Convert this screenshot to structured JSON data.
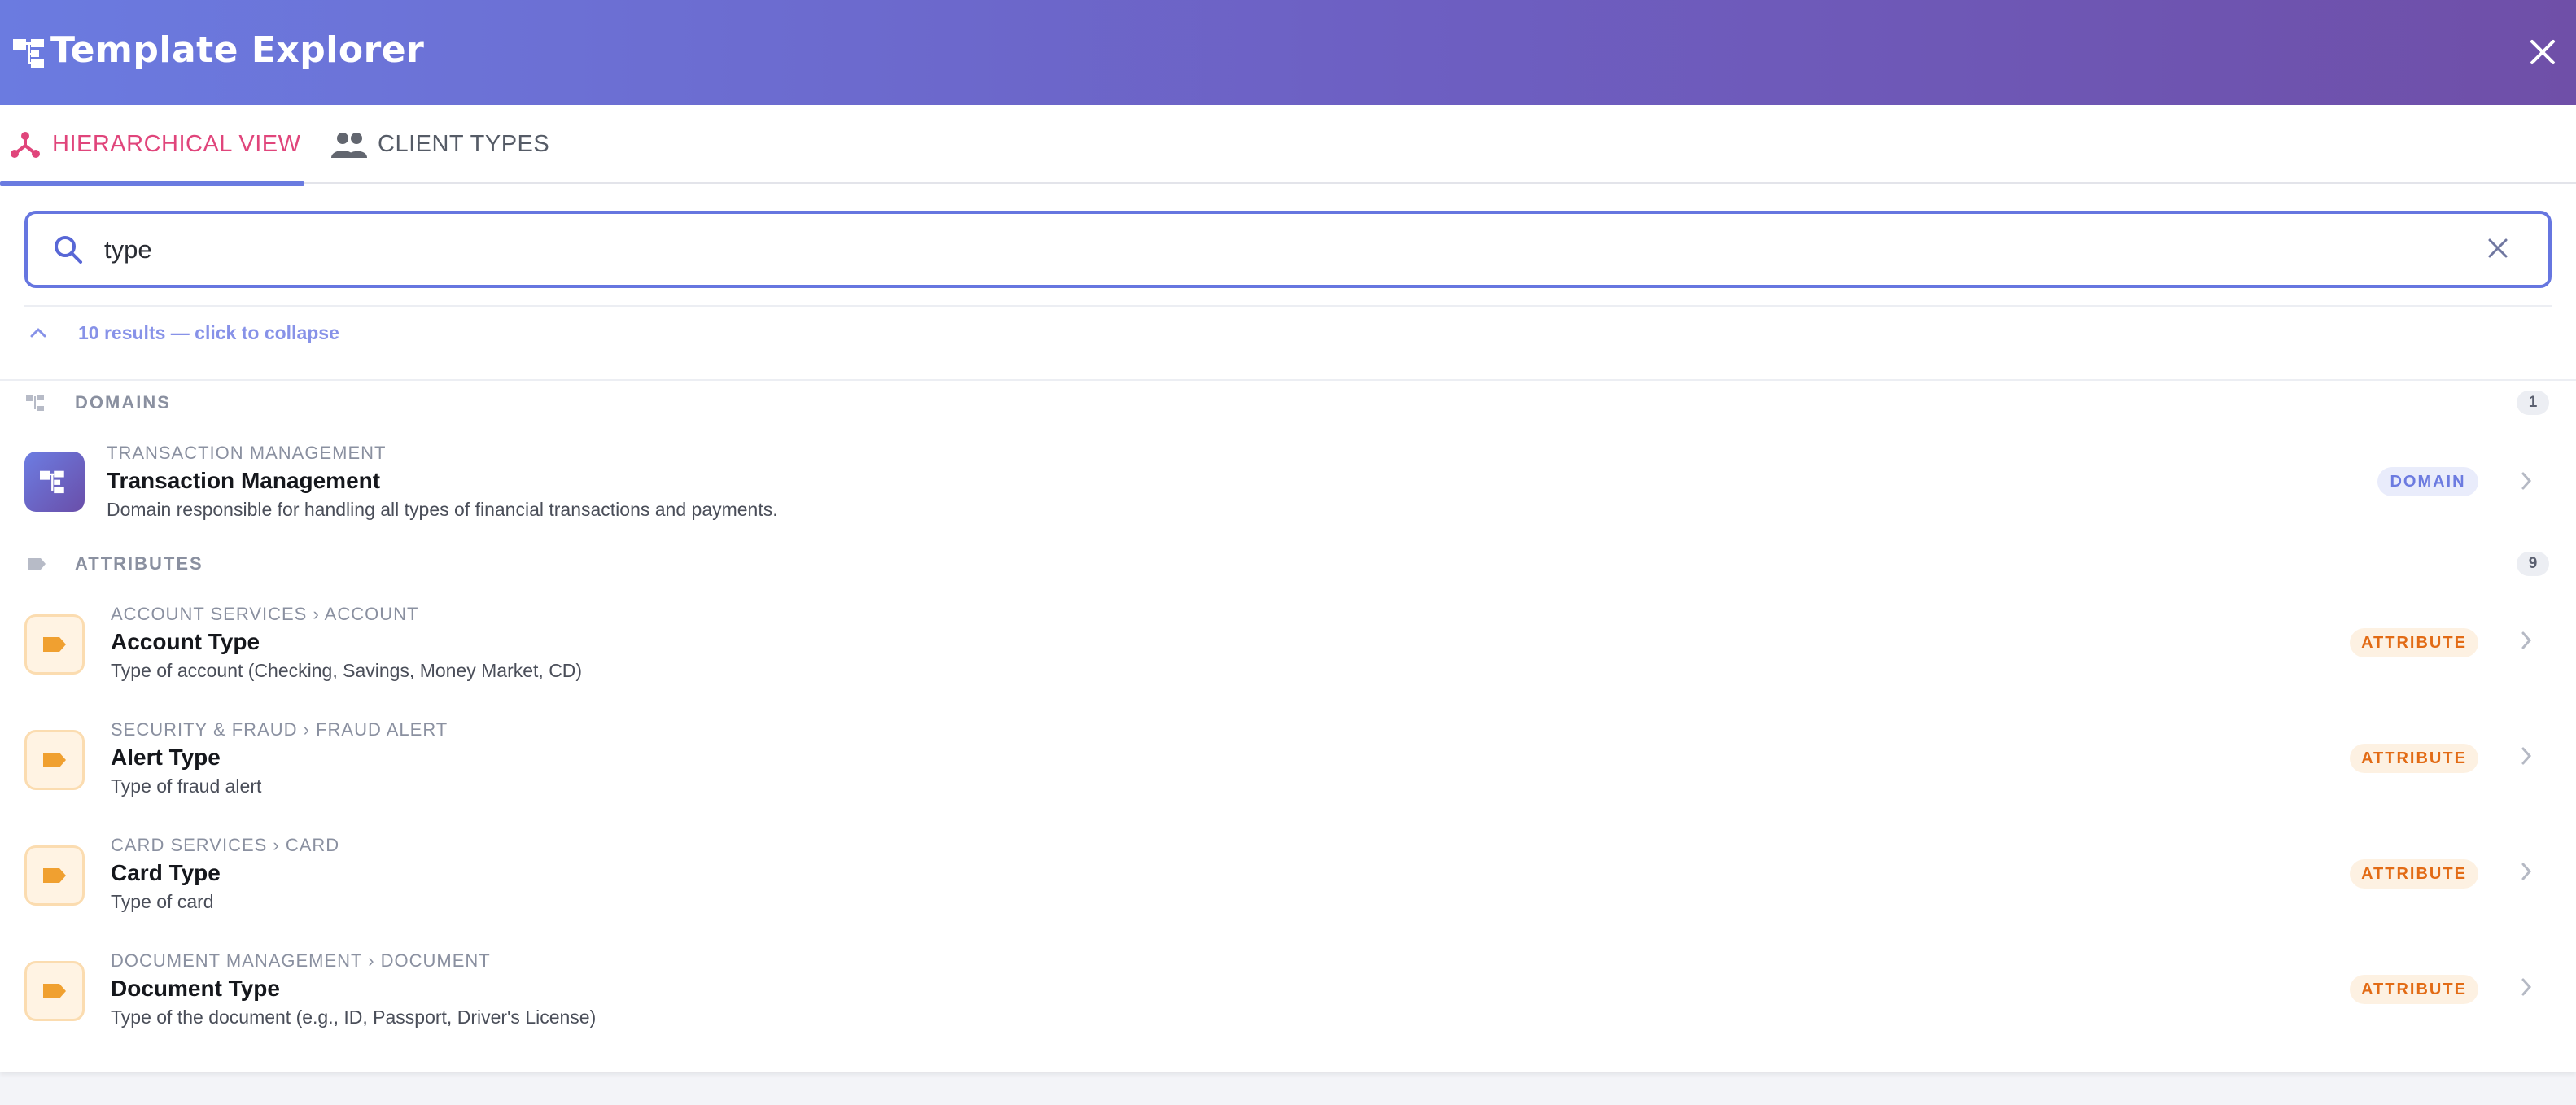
{
  "header": {
    "title": "Template Explorer"
  },
  "tabs": [
    {
      "label": "HIERARCHICAL VIEW",
      "active": true
    },
    {
      "label": "CLIENT TYPES",
      "active": false
    }
  ],
  "search": {
    "value": "type",
    "placeholder": ""
  },
  "results_toggle": "10 results — click to collapse",
  "colors": {
    "accent": "#6676e0",
    "active_tab": "#e0457b",
    "attribute": "#e26b15"
  },
  "sections": {
    "domains": {
      "label": "DOMAINS",
      "count": "1",
      "items": [
        {
          "path": "TRANSACTION MANAGEMENT",
          "name": "Transaction Management",
          "desc": "Domain responsible for handling all types of financial transactions and payments.",
          "badge": "DOMAIN"
        }
      ]
    },
    "attributes": {
      "label": "ATTRIBUTES",
      "count": "9",
      "items": [
        {
          "path": "ACCOUNT SERVICES › ACCOUNT",
          "name": "Account Type",
          "desc": "Type of account (Checking, Savings, Money Market, CD)",
          "badge": "ATTRIBUTE"
        },
        {
          "path": "SECURITY & FRAUD › FRAUD ALERT",
          "name": "Alert Type",
          "desc": "Type of fraud alert",
          "badge": "ATTRIBUTE"
        },
        {
          "path": "CARD SERVICES › CARD",
          "name": "Card Type",
          "desc": "Type of card",
          "badge": "ATTRIBUTE"
        },
        {
          "path": "DOCUMENT MANAGEMENT › DOCUMENT",
          "name": "Document Type",
          "desc": "Type of the document (e.g., ID, Passport, Driver's License)",
          "badge": "ATTRIBUTE"
        }
      ]
    }
  }
}
